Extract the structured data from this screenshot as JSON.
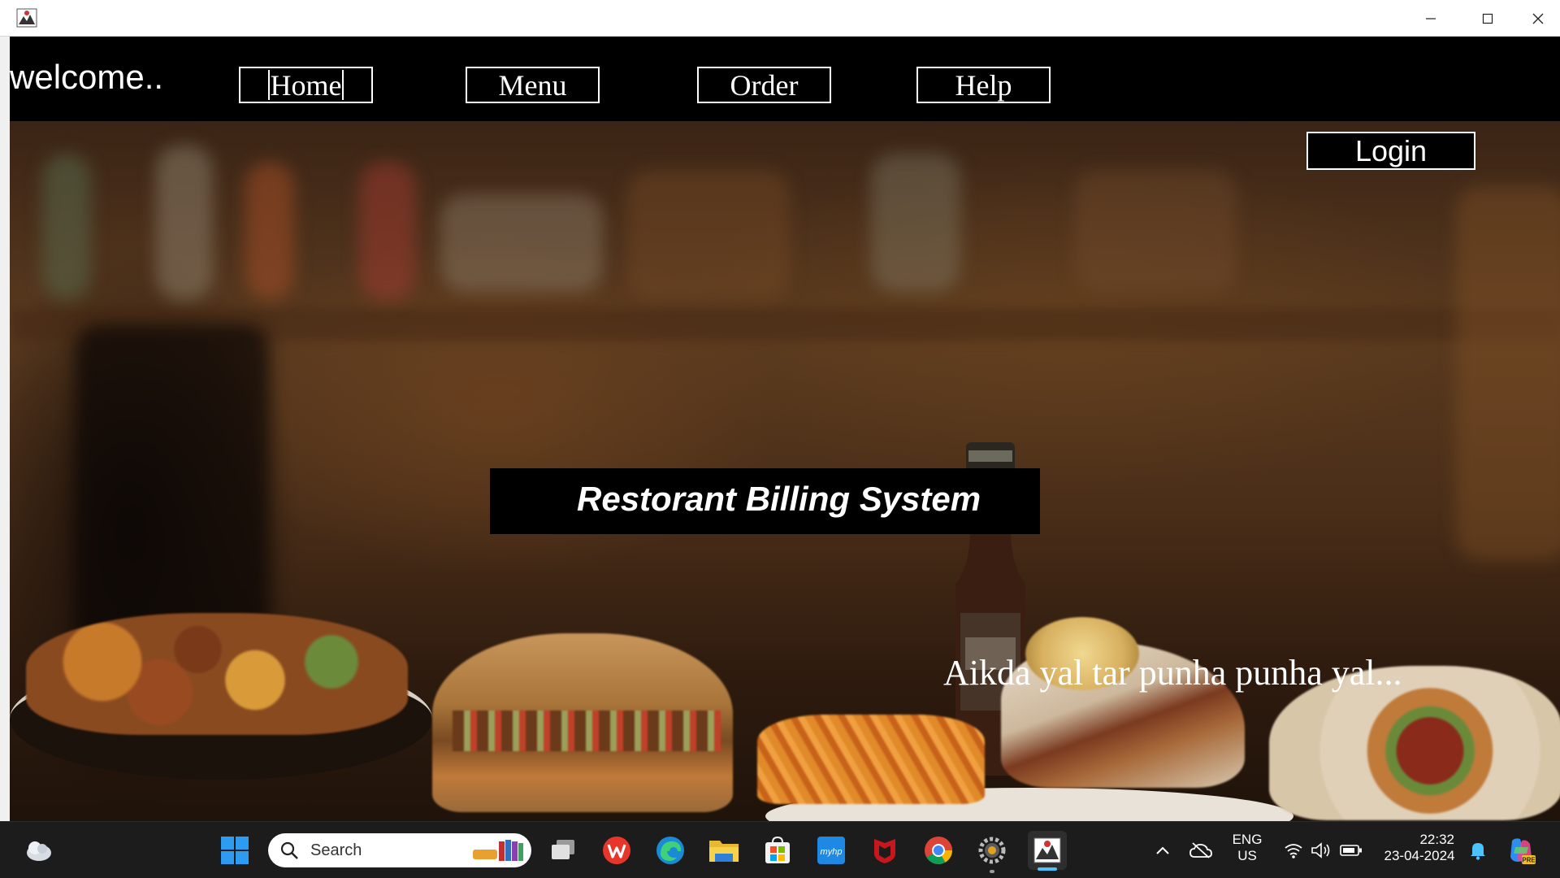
{
  "window": {
    "controls": {
      "minimize_icon": "minimize-icon",
      "maximize_icon": "maximize-icon",
      "close_icon": "close-icon"
    }
  },
  "app": {
    "welcome_text": "welcome..",
    "nav": [
      {
        "label": "Home"
      },
      {
        "label": "Menu"
      },
      {
        "label": "Order"
      },
      {
        "label": "Help"
      }
    ],
    "login_label": "Login",
    "title": "Restorant Billing System",
    "tagline": "Aikda yal tar punha punha yal..."
  },
  "taskbar": {
    "search_placeholder": "Search",
    "lang_top": "ENG",
    "lang_bottom": "US",
    "time": "22:32",
    "date": "23-04-2024",
    "pinned": [
      "widgets-icon",
      "start-icon",
      "task-view-icon",
      "wps-office-icon",
      "edge-icon",
      "file-explorer-icon",
      "microsoft-store-icon",
      "myhp-icon",
      "mcafee-icon",
      "chrome-icon",
      "settings-app-icon",
      "java-app-icon"
    ]
  },
  "colors": {
    "accent": "#4cc2ff",
    "navbar": "#000000",
    "text": "#ffffff"
  }
}
